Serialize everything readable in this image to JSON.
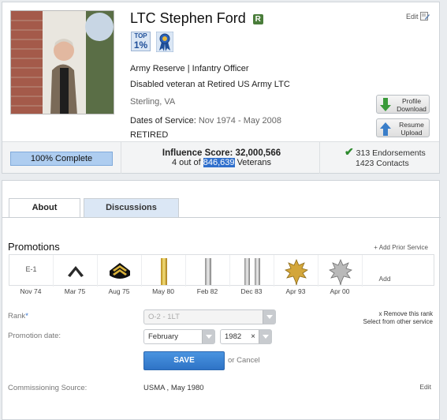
{
  "profile": {
    "name": "LTC Stephen Ford",
    "badge_r": "R",
    "edit_label": "Edit",
    "top_badge": {
      "line1": "TOP",
      "line2": "1%"
    },
    "branch_line": "Army Reserve  |  Infantry Officer",
    "status_line": "Disabled veteran  at Retired US Army LTC",
    "location": "Sterling, VA",
    "dates_label": "Dates of Service:",
    "dates_value": "Nov 1974 - May 2008",
    "retired": "RETIRED",
    "profile_download": "Profile Download",
    "resume_upload": "Resume Upload"
  },
  "stats": {
    "complete": "100% Complete",
    "influence_label": "Influence Score: 32,000,566",
    "rank_prefix": "4 out of",
    "rank_total": "846,639",
    "rank_suffix": "Veterans",
    "endorsements": "313 Endorsements",
    "contacts": "1423 Contacts"
  },
  "tabs": {
    "about": "About",
    "discussions": "Discussions"
  },
  "promotions": {
    "title": "Promotions",
    "add_prior": "+ Add Prior Service",
    "ranks": [
      {
        "icon": "e1-rank-text",
        "text": "E-1",
        "date": "Nov 74"
      },
      {
        "icon": "private-chevron-icon",
        "text": "",
        "date": "Mar 75"
      },
      {
        "icon": "pfc-chevron-icon",
        "text": "",
        "date": "Aug 75"
      },
      {
        "icon": "gold-bar-icon",
        "text": "",
        "date": "May 80"
      },
      {
        "icon": "silver-bar-icon",
        "text": "",
        "date": "Feb 82"
      },
      {
        "icon": "double-silver-bar-icon",
        "text": "",
        "date": "Dec 83"
      },
      {
        "icon": "gold-oak-leaf-icon",
        "text": "",
        "date": "Apr 93"
      },
      {
        "icon": "silver-oak-leaf-icon",
        "text": "",
        "date": "Apr 00"
      },
      {
        "icon": "add-rank",
        "text": "Add",
        "date": ""
      }
    ]
  },
  "form": {
    "rank_label": "Rank",
    "rank_value": "O-2 - 1LT",
    "promotion_label": "Promotion date:",
    "month": "February",
    "year": "1982",
    "remove_rank": "x Remove this rank",
    "select_other": "Select from other service",
    "save": "SAVE",
    "cancel": "or Cancel",
    "commissioning_label": "Commissioning Source:",
    "commissioning_value": "USMA , May 1980",
    "commissioning_edit": "Edit"
  }
}
